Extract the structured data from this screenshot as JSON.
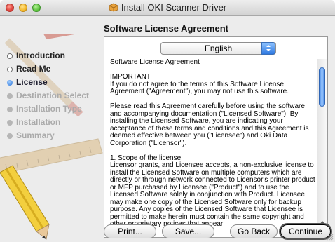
{
  "window": {
    "title": "Install OKI Scanner Driver",
    "header": "Software License Agreement"
  },
  "sidebar": {
    "steps": [
      {
        "label": "Introduction",
        "state": "done"
      },
      {
        "label": "Read Me",
        "state": "done"
      },
      {
        "label": "License",
        "state": "current"
      },
      {
        "label": "Destination Select",
        "state": "pending"
      },
      {
        "label": "Installation Type",
        "state": "pending"
      },
      {
        "label": "Installation",
        "state": "pending"
      },
      {
        "label": "Summary",
        "state": "pending"
      }
    ]
  },
  "language": {
    "selected": "English"
  },
  "license": {
    "paragraphs": [
      "Software License Agreement",
      "IMPORTANT\nIf you do not agree to the terms of this Software License Agreement (\"Agreement\"), you may not use this software.",
      "Please read this Agreement carefully before using the software and accompanying documentation (\"Licensed Software\"). By installing the Licensed Software, you are indicating your acceptance of these terms and conditions and this Agreement is deemed effective between you (\"Licensee\") and Oki Data Corporation (\"Licensor\").",
      "1.  Scope of the license\nLicensor grants, and Licensee accepts, a non-exclusive license to install the Licensed Software on multiple computers which are directly or through network connected to Licensor's printer product or MFP purchased by Licensee (\"Product\") and to use the Licensed Software solely in conjunction with Product. Licensee may make one copy of the Licensed Software only for backup purpose. Any copies of the Licensed Software that Licensee is permitted to make herein must contain the same copyright and other proprietary notices that appear"
    ]
  },
  "buttons": {
    "print": "Print...",
    "save": "Save...",
    "back": "Go Back",
    "continue": "Continue"
  },
  "icons": [
    "close-button",
    "minimize-button",
    "zoom-button",
    "installer-package-icon",
    "pencil-ruler-art",
    "scroll-thumb",
    "scroll-up-arrow",
    "scroll-down-arrow",
    "resize-grip"
  ]
}
